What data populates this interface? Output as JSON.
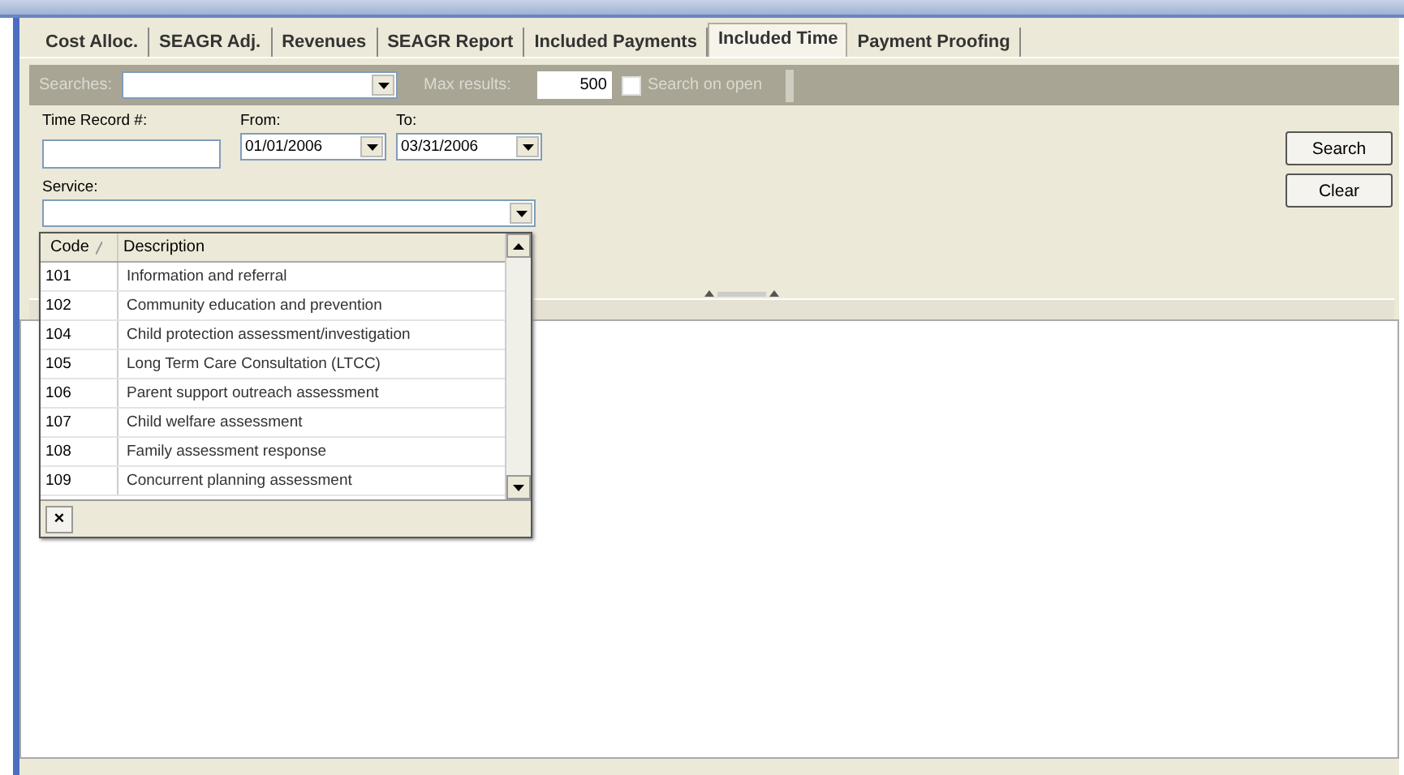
{
  "tabs": [
    {
      "label": "Cost Alloc.",
      "selected": false
    },
    {
      "label": "SEAGR Adj.",
      "selected": false
    },
    {
      "label": "Revenues",
      "selected": false
    },
    {
      "label": "SEAGR Report",
      "selected": false
    },
    {
      "label": "Included Payments",
      "selected": false
    },
    {
      "label": "Included Time",
      "selected": true
    },
    {
      "label": "Payment Proofing",
      "selected": false
    }
  ],
  "toolbar": {
    "searches_label": "Searches:",
    "max_results_label": "Max results:",
    "max_results": "500",
    "search_on_open": {
      "label": "Search on open",
      "checked": false
    }
  },
  "form": {
    "time_record": {
      "label": "Time Record #:"
    },
    "from": {
      "label": "From:",
      "value": "01/01/2006"
    },
    "to": {
      "label": "To:",
      "value": "03/31/2006"
    },
    "service": {
      "label": "Service:"
    }
  },
  "service_list": {
    "columns": [
      "Code",
      "Description"
    ],
    "rows": [
      {
        "code": "101",
        "description": "Information and referral"
      },
      {
        "code": "102",
        "description": "Community education and prevention"
      },
      {
        "code": "104",
        "description": "Child protection assessment/investigation"
      },
      {
        "code": "105",
        "description": "Long Term Care Consultation (LTCC)"
      },
      {
        "code": "106",
        "description": "Parent support outreach assessment"
      },
      {
        "code": "107",
        "description": "Child welfare assessment"
      },
      {
        "code": "108",
        "description": "Family assessment response"
      },
      {
        "code": "109",
        "description": "Concurrent planning assessment"
      }
    ],
    "close_button": "×"
  },
  "buttons": [
    "Search",
    "Clear"
  ]
}
